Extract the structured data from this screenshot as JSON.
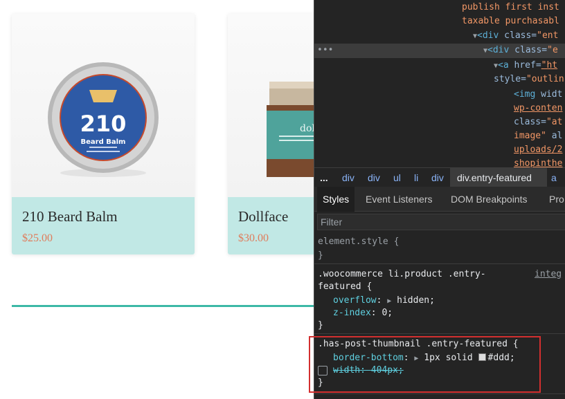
{
  "products": [
    {
      "name": "210 Beard Balm",
      "price": "$25.00",
      "image_alt": "beard balm tin"
    },
    {
      "name": "Dollface",
      "price": "$30.00",
      "image_alt": "dollface jar"
    }
  ],
  "devtools": {
    "dom_lines": {
      "l1": "publish first inst",
      "l2": "taxable purchasabl",
      "l3_tag": "<div",
      "l3_attr": " class=",
      "l3_val": "\"ent",
      "l4_dots": "•••",
      "l4_tag": "<div",
      "l4_attr": " class=",
      "l4_val": "\"e",
      "l5_tag": "<a",
      "l5_attr": " href=",
      "l5_val": "\"ht",
      "l6_attr": "style=",
      "l6_val": "\"outlin",
      "l7_tag": "<img",
      "l7_attr": " widt",
      "l8": "wp-conten",
      "l9_attr": "class=",
      "l9_val": "\"at",
      "l10_val": "image\"",
      "l10_attr": " al",
      "l11": "uploads/2",
      "l12": "shopinthe"
    },
    "breadcrumbs": [
      "...",
      "div",
      "div",
      "ul",
      "li",
      "div",
      "div.entry-featured",
      "a"
    ],
    "tabs": [
      "Styles",
      "Event Listeners",
      "DOM Breakpoints",
      "Pro"
    ],
    "filter_placeholder": "Filter",
    "styles": {
      "element_style": "element.style {",
      "close_brace": "}",
      "rule1_selector_a": ".woocommerce li.product .entry-",
      "rule1_selector_b": "featured {",
      "rule1_source": "integ",
      "rule1_p1_name": "overflow",
      "rule1_p1_val": "hidden;",
      "rule1_p2_name": "z-index",
      "rule1_p2_val": "0;",
      "rule2_selector": ".has-post-thumbnail .entry-featured {",
      "rule2_p1_name": "border-bottom",
      "rule2_p1_val_a": "1px solid",
      "rule2_p1_val_b": "#ddd;",
      "rule2_p2_name": "width",
      "rule2_p2_val": "404px;"
    },
    "colors": {
      "highlight_border": "#d32f2f",
      "card_info_bg": "#c1e8e5",
      "price": "#e07b5a",
      "teal_rule": "#3cb8a6"
    }
  }
}
